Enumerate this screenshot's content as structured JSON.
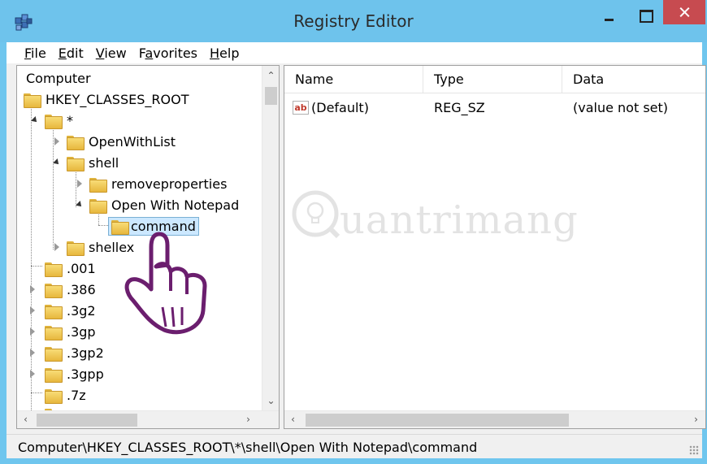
{
  "window": {
    "title": "Registry Editor",
    "accent": "#6ec3ec",
    "close_color": "#c74b50"
  },
  "menu": {
    "items": [
      {
        "label": "File",
        "accel": "F",
        "rest": "ile"
      },
      {
        "label": "Edit",
        "accel": "E",
        "rest": "dit"
      },
      {
        "label": "View",
        "accel": "V",
        "rest": "iew"
      },
      {
        "label": "Favorites",
        "accel": "a",
        "pre": "F",
        "rest": "vorites"
      },
      {
        "label": "Help",
        "accel": "H",
        "rest": "elp"
      }
    ]
  },
  "tree": {
    "root": "Computer",
    "nodes": [
      {
        "label": "HKEY_CLASSES_ROOT",
        "state": "none"
      },
      {
        "label": "*",
        "state": "expanded"
      },
      {
        "label": "OpenWithList",
        "state": "collapsed"
      },
      {
        "label": "shell",
        "state": "expanded"
      },
      {
        "label": "removeproperties",
        "state": "collapsed"
      },
      {
        "label": "Open With Notepad",
        "state": "expanded"
      },
      {
        "label": "command",
        "state": "selected"
      },
      {
        "label": "shellex",
        "state": "collapsed"
      },
      {
        "label": ".001",
        "state": "none"
      },
      {
        "label": ".386",
        "state": "collapsed"
      },
      {
        "label": ".3g2",
        "state": "collapsed"
      },
      {
        "label": ".3gp",
        "state": "collapsed"
      },
      {
        "label": ".3gp2",
        "state": "collapsed"
      },
      {
        "label": ".3gpp",
        "state": "collapsed"
      },
      {
        "label": ".7z",
        "state": "none"
      }
    ]
  },
  "list": {
    "columns": [
      "Name",
      "Type",
      "Data"
    ],
    "rows": [
      {
        "icon": "string-value-icon",
        "icon_text": "ab",
        "name": "(Default)",
        "type": "REG_SZ",
        "data": "(value not set)"
      }
    ]
  },
  "watermark": {
    "text": "uantrimang"
  },
  "status": {
    "path": "Computer\\HKEY_CLASSES_ROOT\\*\\shell\\Open With Notepad\\command"
  }
}
